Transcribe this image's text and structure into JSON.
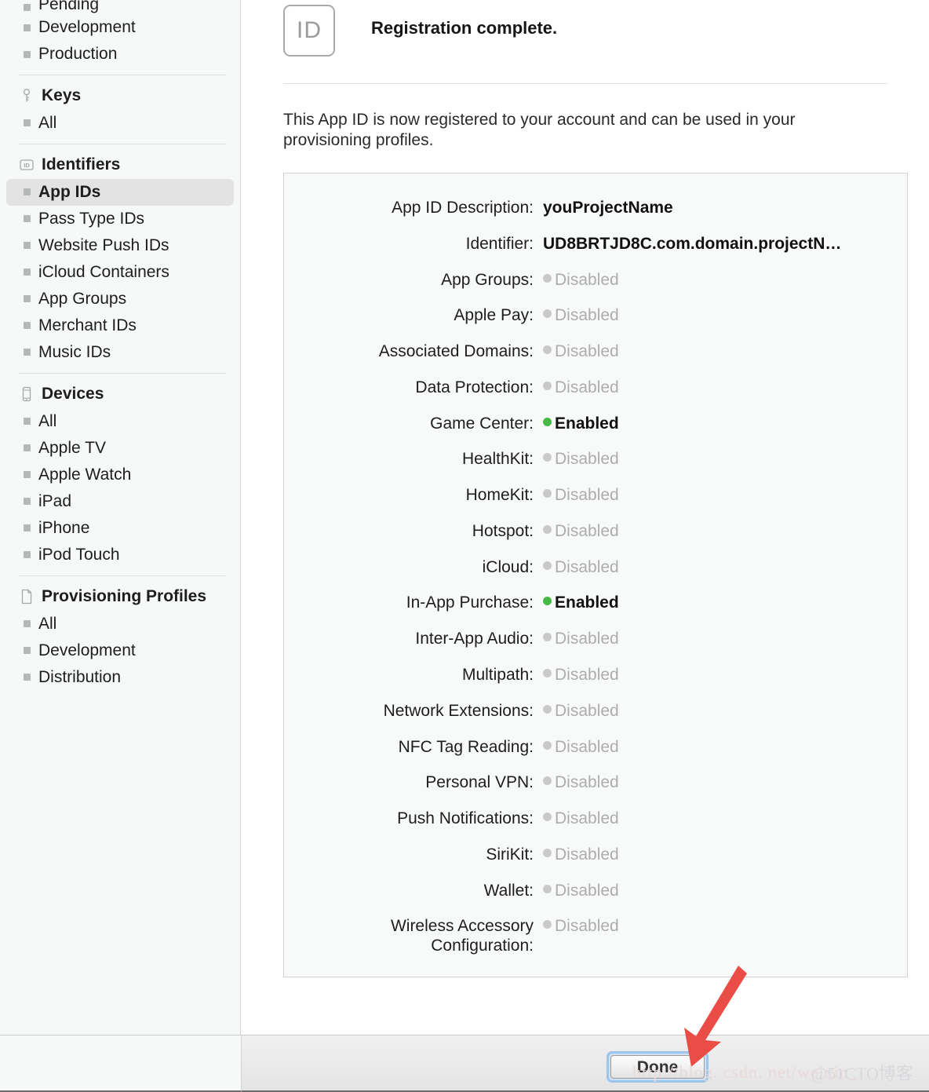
{
  "sidebar": {
    "groups": [
      {
        "name": "certificates-continued",
        "header": null,
        "icon": null,
        "items": [
          {
            "label": "Pending",
            "selected": false,
            "clipped": true
          },
          {
            "label": "Development",
            "selected": false
          },
          {
            "label": "Production",
            "selected": false
          }
        ]
      },
      {
        "name": "keys",
        "header": "Keys",
        "icon": "key-icon",
        "items": [
          {
            "label": "All",
            "selected": false
          }
        ]
      },
      {
        "name": "identifiers",
        "header": "Identifiers",
        "icon": "id-badge-icon",
        "items": [
          {
            "label": "App IDs",
            "selected": true
          },
          {
            "label": "Pass Type IDs",
            "selected": false
          },
          {
            "label": "Website Push IDs",
            "selected": false
          },
          {
            "label": "iCloud Containers",
            "selected": false
          },
          {
            "label": "App Groups",
            "selected": false
          },
          {
            "label": "Merchant IDs",
            "selected": false
          },
          {
            "label": "Music IDs",
            "selected": false
          }
        ]
      },
      {
        "name": "devices",
        "header": "Devices",
        "icon": "device-icon",
        "items": [
          {
            "label": "All",
            "selected": false
          },
          {
            "label": "Apple TV",
            "selected": false
          },
          {
            "label": "Apple Watch",
            "selected": false
          },
          {
            "label": "iPad",
            "selected": false
          },
          {
            "label": "iPhone",
            "selected": false
          },
          {
            "label": "iPod Touch",
            "selected": false
          }
        ]
      },
      {
        "name": "provisioning-profiles",
        "header": "Provisioning Profiles",
        "icon": "document-icon",
        "items": [
          {
            "label": "All",
            "selected": false
          },
          {
            "label": "Development",
            "selected": false
          },
          {
            "label": "Distribution",
            "selected": false
          }
        ]
      }
    ]
  },
  "main": {
    "badge_text": "ID",
    "title": "Registration complete.",
    "intro": "This App ID is now registered to your account and can be used in your provisioning profiles.",
    "details": [
      {
        "label": "App ID Description:",
        "value": "youProjectName",
        "state": "plain"
      },
      {
        "label": "Identifier:",
        "value": "UD8BRTJD8C.com.domain.projectN…",
        "state": "plain"
      },
      {
        "label": "App Groups:",
        "value": "Disabled",
        "state": "disabled"
      },
      {
        "label": "Apple Pay:",
        "value": "Disabled",
        "state": "disabled"
      },
      {
        "label": "Associated Domains:",
        "value": "Disabled",
        "state": "disabled"
      },
      {
        "label": "Data Protection:",
        "value": "Disabled",
        "state": "disabled"
      },
      {
        "label": "Game Center:",
        "value": "Enabled",
        "state": "enabled"
      },
      {
        "label": "HealthKit:",
        "value": "Disabled",
        "state": "disabled"
      },
      {
        "label": "HomeKit:",
        "value": "Disabled",
        "state": "disabled"
      },
      {
        "label": "Hotspot:",
        "value": "Disabled",
        "state": "disabled"
      },
      {
        "label": "iCloud:",
        "value": "Disabled",
        "state": "disabled"
      },
      {
        "label": "In-App Purchase:",
        "value": "Enabled",
        "state": "enabled"
      },
      {
        "label": "Inter-App Audio:",
        "value": "Disabled",
        "state": "disabled"
      },
      {
        "label": "Multipath:",
        "value": "Disabled",
        "state": "disabled"
      },
      {
        "label": "Network Extensions:",
        "value": "Disabled",
        "state": "disabled"
      },
      {
        "label": "NFC Tag Reading:",
        "value": "Disabled",
        "state": "disabled"
      },
      {
        "label": "Personal VPN:",
        "value": "Disabled",
        "state": "disabled"
      },
      {
        "label": "Push Notifications:",
        "value": "Disabled",
        "state": "disabled"
      },
      {
        "label": "SiriKit:",
        "value": "Disabled",
        "state": "disabled"
      },
      {
        "label": "Wallet:",
        "value": "Disabled",
        "state": "disabled"
      },
      {
        "label": "Wireless Accessory Configuration:",
        "value": "Disabled",
        "state": "disabled"
      }
    ]
  },
  "footer": {
    "done_label": "Done"
  },
  "annotation": {
    "arrow_color": "#ea4d46",
    "arrow_name": "red-pointer-arrow"
  },
  "watermark": {
    "url": "http://blog. csdn. net/weixin_",
    "site": "@51CTO博客"
  },
  "colors": {
    "sidebar_bg": "#f7f9f9",
    "content_bg": "#ffffff",
    "detail_box_bg": "#f8faf9",
    "enabled_dot": "#46b946",
    "disabled_dot": "#c9c9c9",
    "selected_item_bg": "#e3e3e3",
    "focus_ring": "#9cc5ec"
  }
}
